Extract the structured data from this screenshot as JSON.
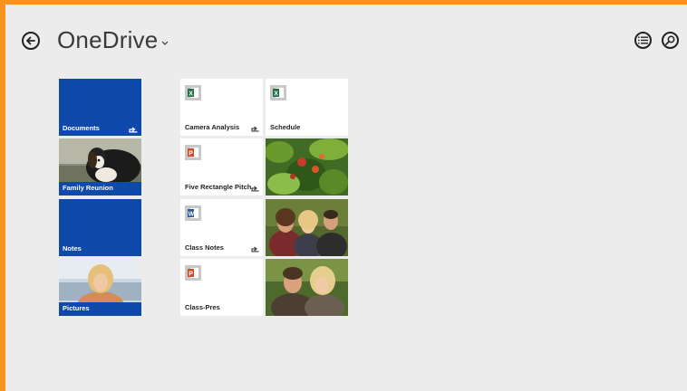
{
  "app": {
    "title": "OneDrive"
  },
  "icons": {
    "back": "back-arrow-icon",
    "title_menu": "chevron-down-icon",
    "list_view": "list-view-icon",
    "search": "search-icon",
    "shared": "shared-icon",
    "excel": "excel-file-icon",
    "powerpoint": "powerpoint-file-icon",
    "word": "word-file-icon"
  },
  "colors": {
    "accent_frame": "#f7931d",
    "folder_tile": "#0f4aab",
    "background": "#ececec"
  },
  "folders": [
    {
      "label": "Documents",
      "type": "folder",
      "shared": true
    },
    {
      "label": "Family Reunion",
      "type": "photo-folder",
      "shared": false
    },
    {
      "label": "Notes",
      "type": "folder",
      "shared": false
    },
    {
      "label": "Pictures",
      "type": "photo-folder",
      "shared": false
    }
  ],
  "files": [
    {
      "label": "Camera Analysis",
      "type": "excel",
      "shared": true
    },
    {
      "label": "Schedule",
      "type": "excel",
      "shared": false
    },
    {
      "label": "Five Rectangle Pitch",
      "type": "powerpoint",
      "shared": true
    },
    {
      "label": "Class Notes",
      "type": "word",
      "shared": true
    },
    {
      "label": "Class-Pres",
      "type": "powerpoint",
      "shared": false
    }
  ],
  "photos": [
    {
      "subject": "plant photo"
    },
    {
      "subject": "group photo"
    },
    {
      "subject": "couple photo"
    }
  ]
}
